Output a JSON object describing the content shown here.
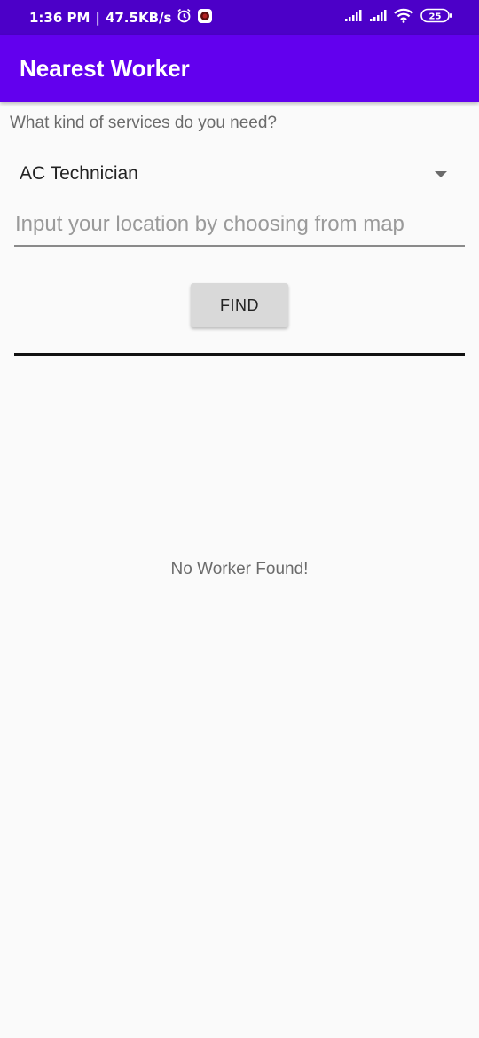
{
  "status_bar": {
    "time": "1:36 PM",
    "network_speed": "47.5KB/s",
    "battery": "25",
    "icons": [
      "alarm-icon",
      "app-notification-icon",
      "signal-icon",
      "signal-icon",
      "wifi-icon",
      "battery-icon"
    ]
  },
  "app_bar": {
    "title": "Nearest Worker",
    "color": "#6200ee"
  },
  "form": {
    "prompt": "What kind of services do you need?",
    "service_selected": "AC Technician",
    "location_placeholder": "Input your location by choosing from map",
    "location_value": "",
    "find_label": "FIND"
  },
  "results": {
    "empty_message": "No Worker Found!"
  }
}
